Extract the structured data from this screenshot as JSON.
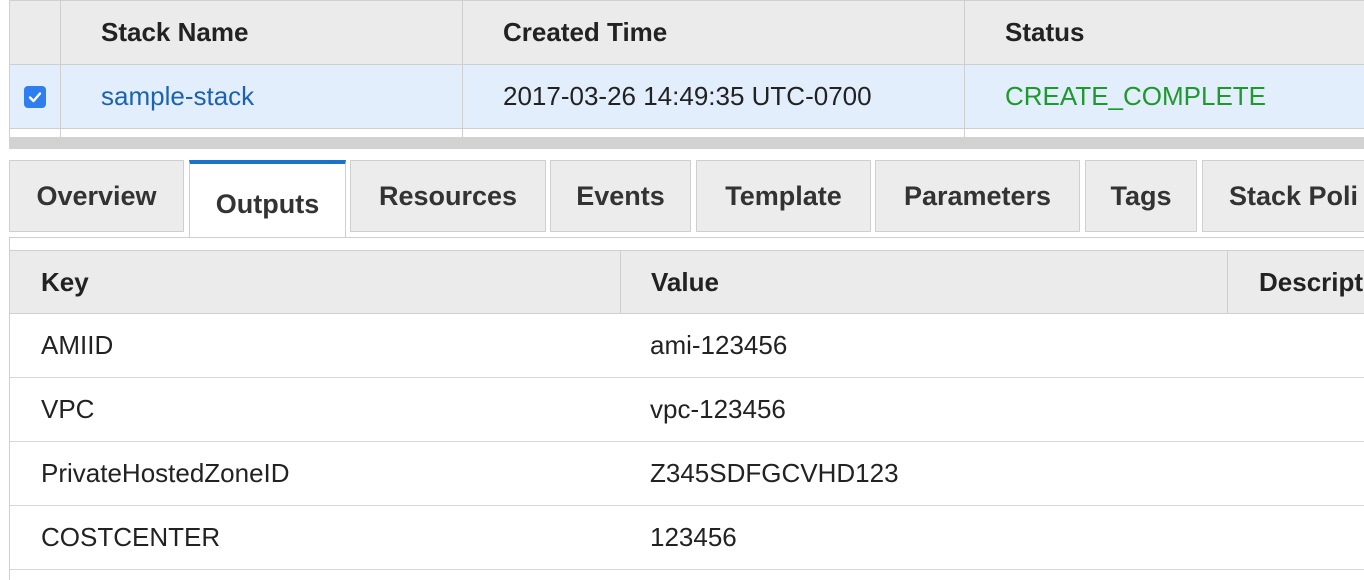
{
  "stack_table": {
    "columns": [
      "Stack Name",
      "Created Time",
      "Status"
    ],
    "row": {
      "selected": true,
      "stack_name": "sample-stack",
      "created_time": "2017-03-26 14:49:35 UTC-0700",
      "status": "CREATE_COMPLETE"
    }
  },
  "tabs": [
    {
      "label": "Overview",
      "active": false
    },
    {
      "label": "Outputs",
      "active": true
    },
    {
      "label": "Resources",
      "active": false
    },
    {
      "label": "Events",
      "active": false
    },
    {
      "label": "Template",
      "active": false
    },
    {
      "label": "Parameters",
      "active": false
    },
    {
      "label": "Tags",
      "active": false
    },
    {
      "label": "Stack Poli",
      "active": false
    }
  ],
  "outputs": {
    "columns": [
      "Key",
      "Value",
      "Descript"
    ],
    "rows": [
      {
        "key": "AMIID",
        "value": "ami-123456",
        "description": ""
      },
      {
        "key": "VPC",
        "value": "vpc-123456",
        "description": ""
      },
      {
        "key": "PrivateHostedZoneID",
        "value": "Z345SDFGCVHD123",
        "description": ""
      },
      {
        "key": "COSTCENTER",
        "value": "123456",
        "description": ""
      }
    ]
  },
  "colors": {
    "link": "#1b63b1",
    "status_complete": "#1c9a2c",
    "active_tab_accent": "#1a72c9",
    "selected_row": "#e3eefc",
    "checkbox": "#2f7ef0"
  },
  "icons": {
    "row_checkbox": "checkbox-checked-icon"
  }
}
